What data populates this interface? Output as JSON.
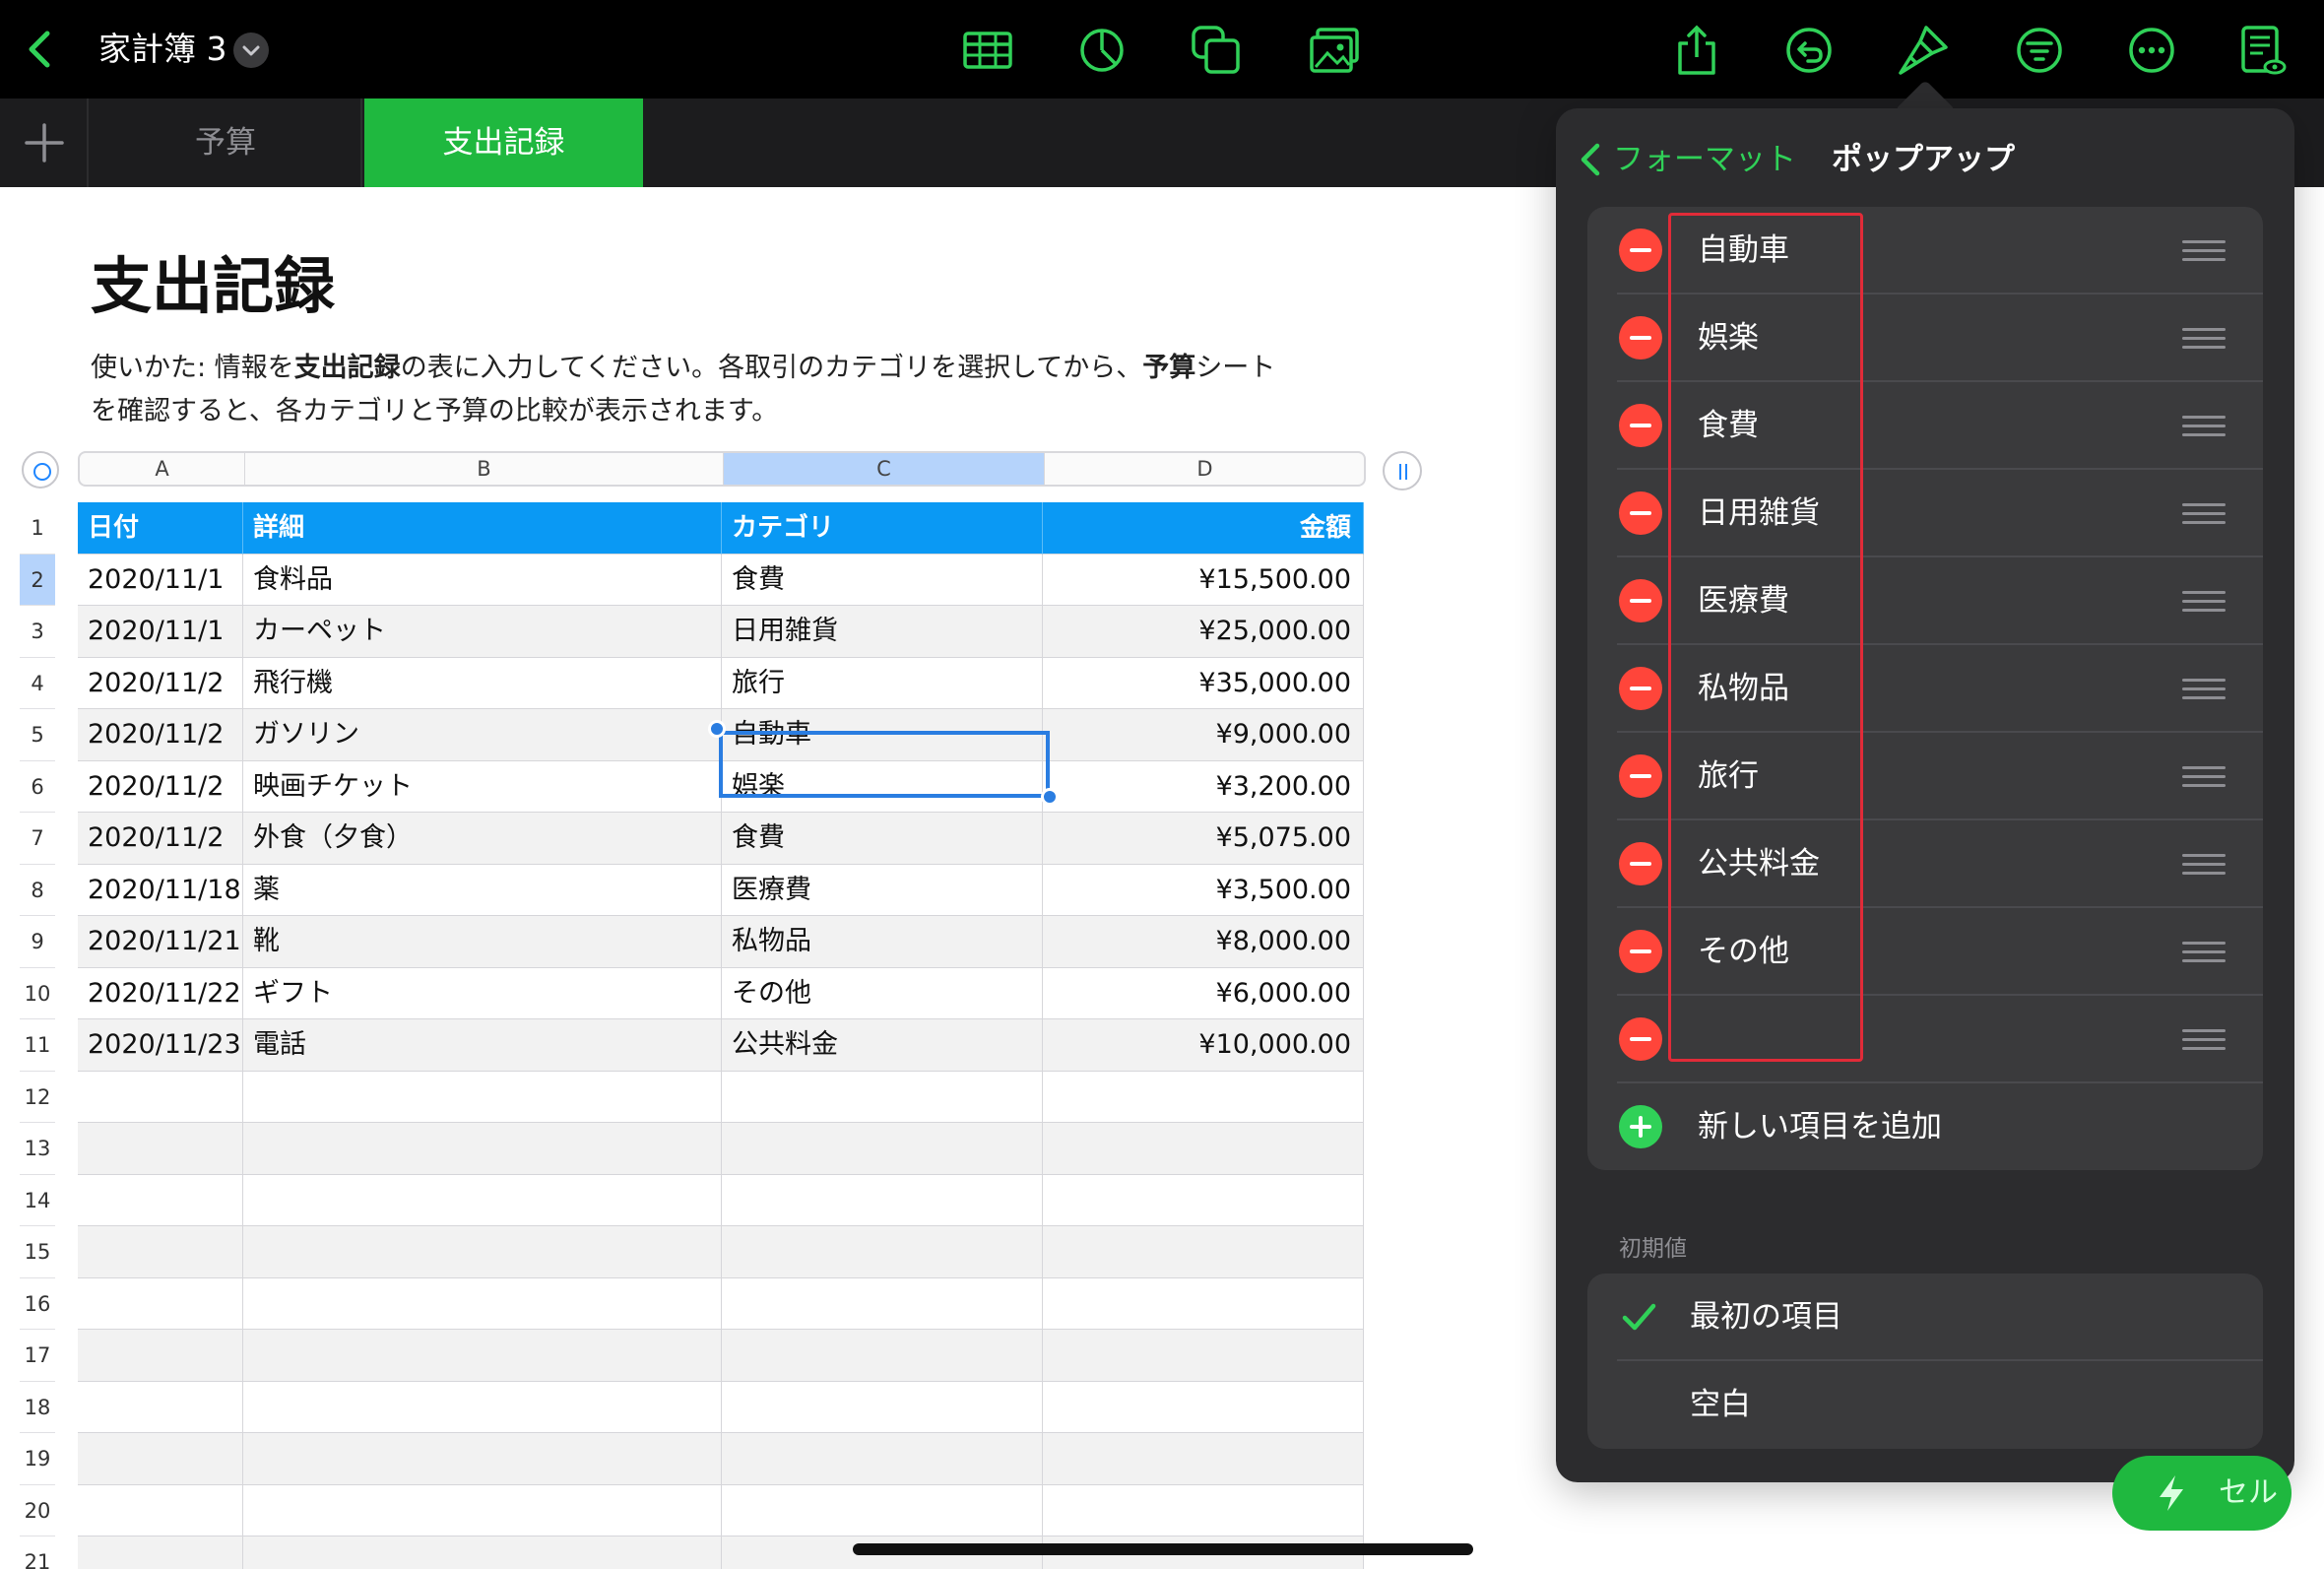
{
  "toolbar": {
    "doc_title": "家計簿 3",
    "icons": [
      "back-chevron-icon",
      "table-icon",
      "chart-icon",
      "shapes-icon",
      "media-icon",
      "share-icon",
      "undo-icon",
      "format-brush-icon",
      "organize-icon",
      "more-icon",
      "document-view-icon"
    ]
  },
  "tabs": [
    {
      "label": "予算",
      "active": false
    },
    {
      "label": "支出記録",
      "active": true
    }
  ],
  "sheet": {
    "heading": "支出記録",
    "intro": {
      "p1": "使いかた: 情報を",
      "b1": "支出記録",
      "p2": "の表に入力してください。各取引のカテゴリを選択してから、",
      "b2": "予算",
      "p3": "シート",
      "p4": "を確認すると、各カテゴリと予算の比較が表示されます。"
    }
  },
  "table": {
    "column_letters": [
      "A",
      "B",
      "C",
      "D"
    ],
    "selected_column": "C",
    "selected_row": 2,
    "headers": [
      "日付",
      "詳細",
      "カテゴリ",
      "金額"
    ],
    "rows": [
      [
        "2020/11/1",
        "食料品",
        "食費",
        "¥15,500.00"
      ],
      [
        "2020/11/1",
        "カーペット",
        "日用雑貨",
        "¥25,000.00"
      ],
      [
        "2020/11/2",
        "飛行機",
        "旅行",
        "¥35,000.00"
      ],
      [
        "2020/11/2",
        "ガソリン",
        "自動車",
        "¥9,000.00"
      ],
      [
        "2020/11/2",
        "映画チケット",
        "娯楽",
        "¥3,200.00"
      ],
      [
        "2020/11/2",
        "外食（夕食）",
        "食費",
        "¥5,075.00"
      ],
      [
        "2020/11/18",
        "薬",
        "医療費",
        "¥3,500.00"
      ],
      [
        "2020/11/21",
        "靴",
        "私物品",
        "¥8,000.00"
      ],
      [
        "2020/11/22",
        "ギフト",
        "その他",
        "¥6,000.00"
      ],
      [
        "2020/11/23",
        "電話",
        "公共料金",
        "¥10,000.00"
      ]
    ],
    "empty_row_count": 10
  },
  "popover": {
    "back_label": "フォーマット",
    "title": "ポップアップ",
    "items": [
      "自動車",
      "娯楽",
      "食費",
      "日用雑貨",
      "医療費",
      "私物品",
      "旅行",
      "公共料金",
      "その他",
      ""
    ],
    "add_label": "新しい項目を追加",
    "default_section_label": "初期値",
    "default_options": [
      {
        "label": "最初の項目",
        "checked": true
      },
      {
        "label": "空白",
        "checked": false
      }
    ]
  },
  "cell_button_label": "セル",
  "colors": {
    "accent_green": "#1fb83f",
    "header_blue": "#0a99f4",
    "selection_blue": "#2a7de1",
    "delete_red": "#ff453a",
    "highlight_box": "#e12b38"
  }
}
